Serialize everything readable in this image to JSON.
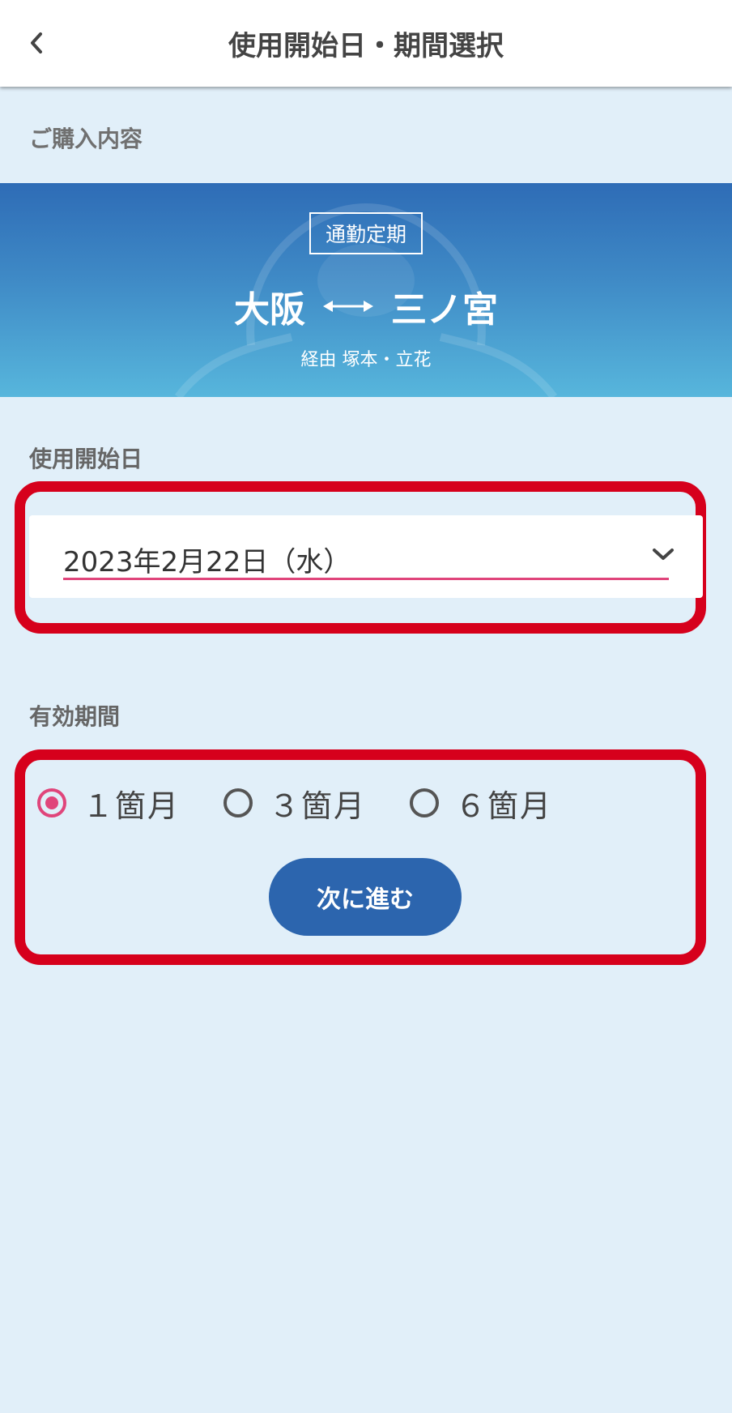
{
  "header": {
    "title": "使用開始日・期間選択",
    "back_icon": "chevron-left-icon"
  },
  "purchase": {
    "section_label": "ご購入内容",
    "ticket_type": "通勤定期",
    "from": "大阪",
    "to": "三ノ宮",
    "route_icon": "double-arrow-icon",
    "via": "経由 塚本・立花"
  },
  "start_date": {
    "label": "使用開始日",
    "value": "2023年2月22日（水）",
    "dropdown_icon": "chevron-down-icon"
  },
  "period": {
    "label": "有効期間",
    "options": [
      {
        "label": "１箇月",
        "selected": true
      },
      {
        "label": "３箇月",
        "selected": false
      },
      {
        "label": "６箇月",
        "selected": false
      }
    ]
  },
  "next_button_label": "次に進む",
  "colors": {
    "background": "#e1eff9",
    "accent_pink": "#e0457b",
    "button_blue": "#2c65ae",
    "highlight_red": "#d6001c",
    "banner_top": "#2e6cb6",
    "banner_bottom": "#57b6dc"
  }
}
